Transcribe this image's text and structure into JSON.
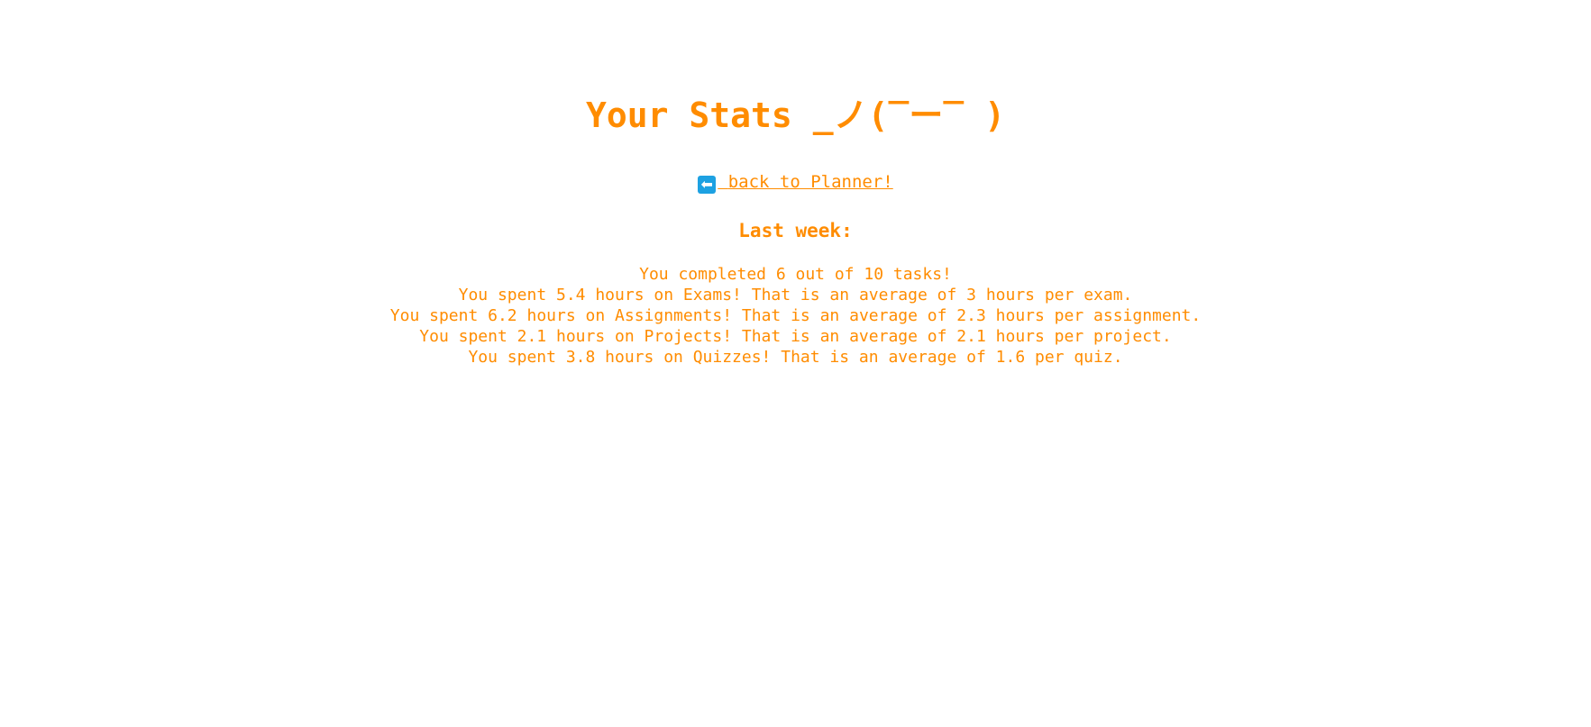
{
  "page": {
    "title": "Your Stats ¯\\_(ツ)_/¯",
    "title_display": "Your Stats _ノ(‾ー‾ )",
    "back_link": {
      "icon": "left-arrow-icon",
      "label": "back to Planner!"
    },
    "section_heading": "Last week:",
    "stats_lines": [
      "You completed 6 out of 10 tasks!",
      "You spent 5.4 hours on Exams! That is an average of 3 hours per exam.",
      "You spent 6.2 hours on Assignments! That is an average of 2.3 hours per assignment.",
      "You spent 2.1 hours on Projects! That is an average of 2.1 hours per project.",
      "You spent 3.8 hours on Quizzes! That is an average of 1.6 per quiz."
    ]
  },
  "colors": {
    "text": "#ff8c00",
    "icon_bg": "#1da1e2",
    "background": "#ffffff"
  }
}
